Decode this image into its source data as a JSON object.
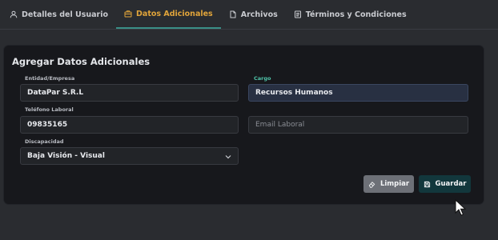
{
  "tabs": [
    {
      "label": "Detalles del Usuario",
      "icon": "user-icon"
    },
    {
      "label": "Datos Adicionales",
      "icon": "briefcase-icon",
      "active": true
    },
    {
      "label": "Archivos",
      "icon": "file-icon"
    },
    {
      "label": "Términos y Condiciones",
      "icon": "document-list-icon"
    }
  ],
  "form": {
    "title": "Agregar Datos Adicionales",
    "entidad": {
      "label": "Entidad/Empresa",
      "value": "DataPar S.R.L"
    },
    "cargo": {
      "label": "Cargo",
      "value": "Recursos Humanos"
    },
    "telefono": {
      "label": "Teléfono Laboral",
      "value": "09835165"
    },
    "email": {
      "placeholder": "Email Laboral"
    },
    "discapacidad": {
      "label": "Discapacidad",
      "value": "Baja Visión - Visual"
    }
  },
  "buttons": {
    "clear_label": "Limpiar",
    "save_label": "Guardar"
  },
  "colors": {
    "active_tab": "#e0a43a",
    "accent": "#4fc2a8",
    "save_button": "#12373c"
  }
}
